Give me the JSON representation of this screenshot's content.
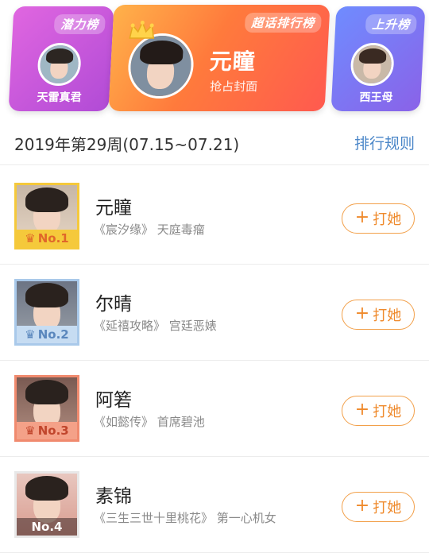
{
  "cards": {
    "left": {
      "tag": "潜力榜",
      "name": "天雷真君",
      "icon": "person-avatar"
    },
    "center": {
      "tag": "超话排行榜",
      "name": "元瞳",
      "subtitle": "抢占封面",
      "icon": "crown-icon"
    },
    "right": {
      "tag": "上升榜",
      "name": "西王母",
      "icon": "person-avatar"
    }
  },
  "week": {
    "title": "2019年第29周(07.15~07.21)",
    "rules_link": "排行规则"
  },
  "ranking": [
    {
      "rank": "No.1",
      "name": "元瞳",
      "desc": "《宸汐缘》 天庭毒瘤",
      "button": "打她",
      "badge_color": "#f5c93b"
    },
    {
      "rank": "No.2",
      "name": "尔晴",
      "desc": "《延禧攻略》 宫廷恶婊",
      "button": "打她",
      "badge_color": "#a9c9ea"
    },
    {
      "rank": "No.3",
      "name": "阿箬",
      "desc": "《如懿传》 首席碧池",
      "button": "打她",
      "badge_color": "#f08a6e"
    },
    {
      "rank": "No.4",
      "name": "素锦",
      "desc": "《三生三世十里桃花》 第一心机女",
      "button": "打她",
      "badge_color": "#e8e8e8"
    }
  ],
  "colors": {
    "accent_orange": "#ef8a2c",
    "link_blue": "#4a86c8",
    "card_left": "#c65ad9",
    "card_center": "#ff7a3c",
    "card_right": "#7b78f0"
  }
}
